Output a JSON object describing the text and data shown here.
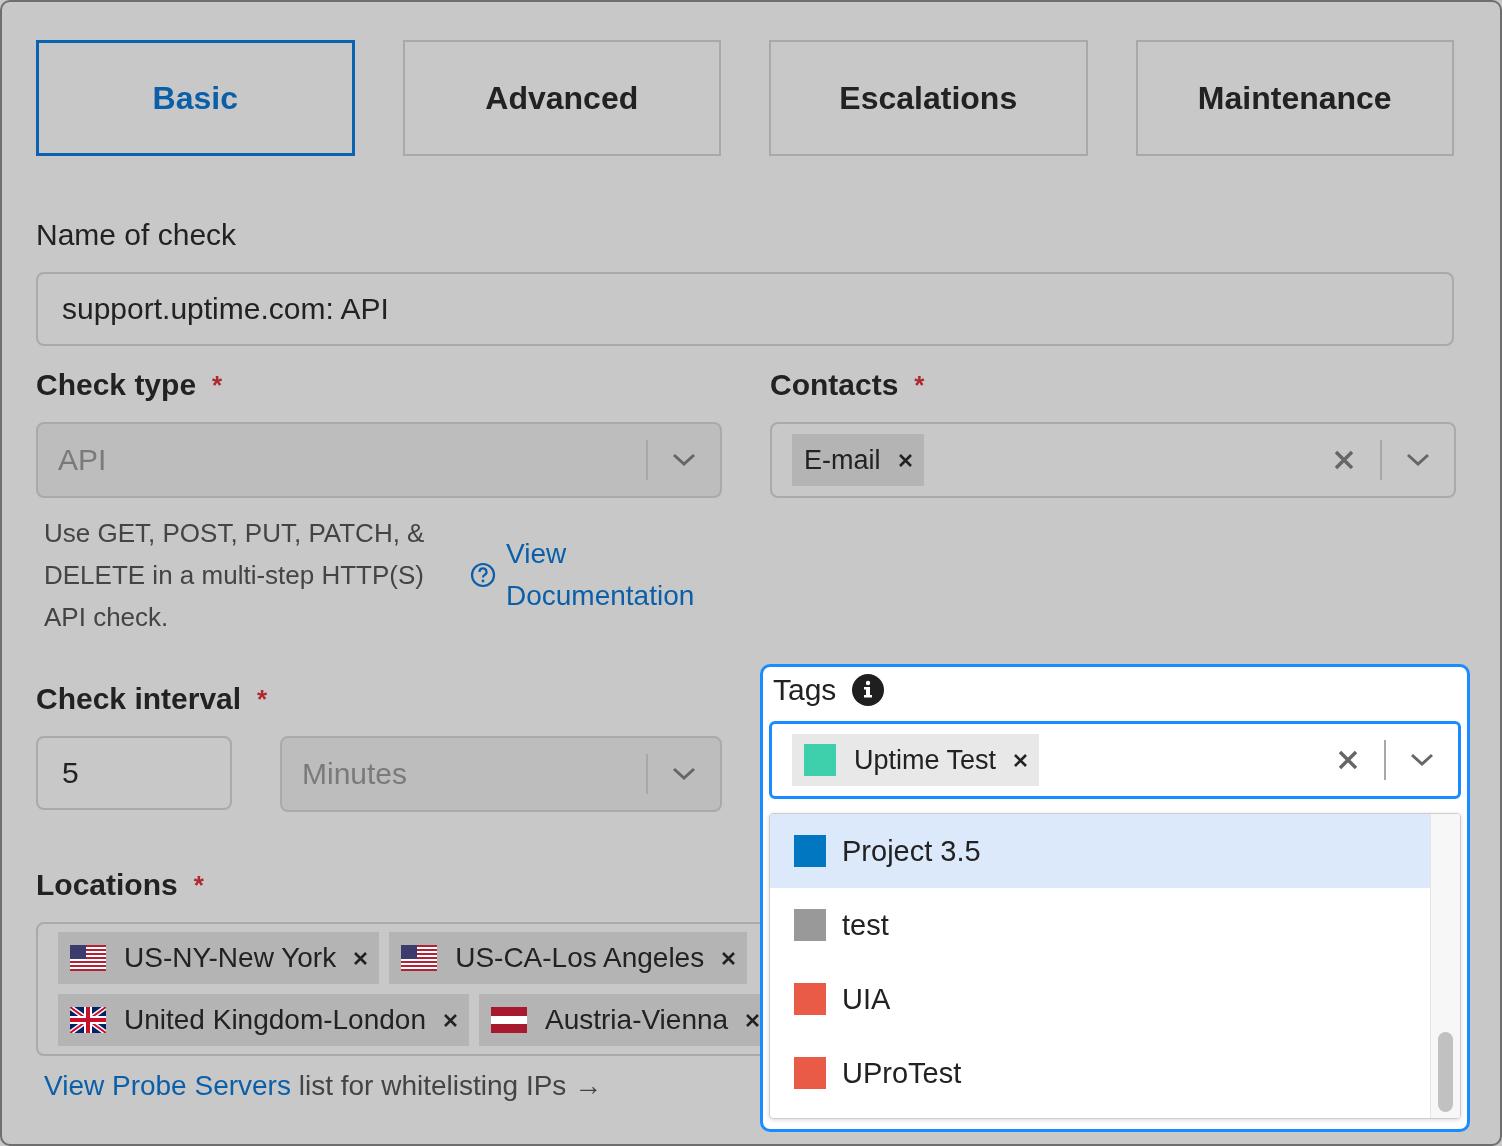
{
  "tabs": [
    {
      "label": "Basic",
      "selected": true
    },
    {
      "label": "Advanced",
      "selected": false
    },
    {
      "label": "Escalations",
      "selected": false
    },
    {
      "label": "Maintenance",
      "selected": false
    }
  ],
  "name_field": {
    "label": "Name of check",
    "value": "support.uptime.com: API"
  },
  "check_type": {
    "label": "Check type",
    "required_mark": "*",
    "value": "API",
    "disabled": true,
    "help": "Use GET, POST, PUT, PATCH, & DELETE in a multi-step HTTP(S) API check.",
    "doc_link": "View Documentation"
  },
  "contacts": {
    "label": "Contacts",
    "required_mark": "*",
    "chips": [
      {
        "label": "E-mail"
      }
    ]
  },
  "check_interval": {
    "label": "Check interval",
    "required_mark": "*",
    "value": "5",
    "unit": "Minutes",
    "unit_disabled": true
  },
  "locations": {
    "label": "Locations",
    "required_mark": "*",
    "chips": [
      {
        "label": "US-NY-New York",
        "kind": "us"
      },
      {
        "label": "US-CA-Los Angeles",
        "kind": "us"
      },
      {
        "label": "United Kingdom-London",
        "kind": "uk"
      },
      {
        "label": "Austria-Vienna",
        "kind": "at"
      }
    ]
  },
  "probe_note": {
    "link": "View Probe Servers",
    "text": "list for whitelisting IPs →"
  },
  "tags": {
    "label": "Tags",
    "chips": [
      {
        "label": "Uptime Test",
        "color": "#3ecfac"
      }
    ],
    "options": [
      {
        "label": "Project 3.5",
        "color": "#0077c0",
        "selected": true
      },
      {
        "label": "test",
        "color": "#999999",
        "selected": false
      },
      {
        "label": "UIA",
        "color": "#e95a47",
        "selected": false
      },
      {
        "label": "UProTest",
        "color": "#e95a47",
        "selected": false
      }
    ]
  }
}
